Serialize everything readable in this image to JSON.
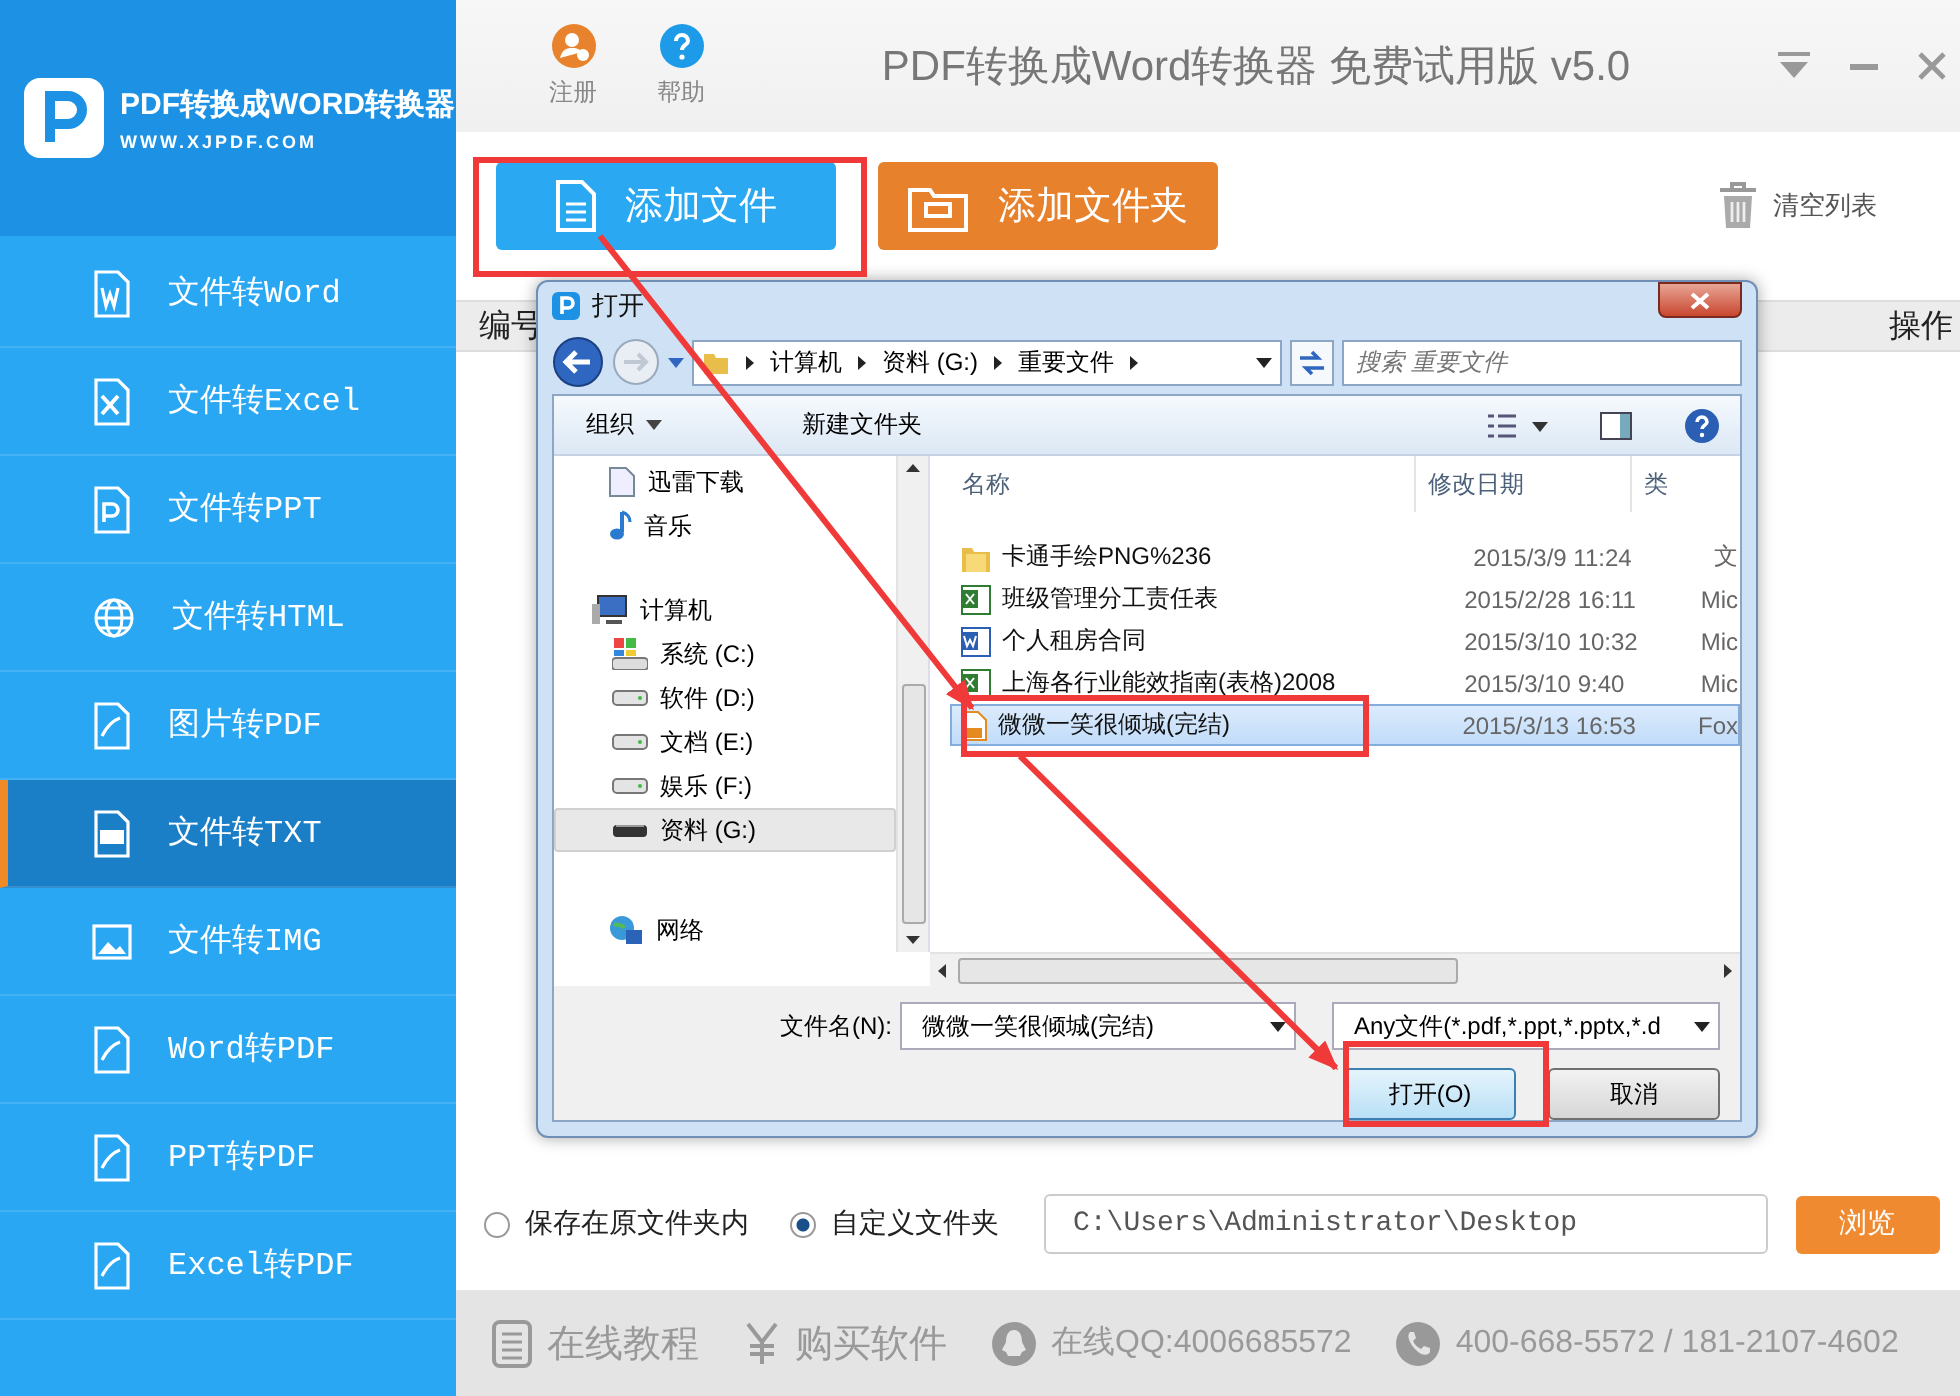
{
  "app": {
    "logo_title": "PDF转换成WORD转换器",
    "logo_url": "WWW.XJPDF.COM",
    "title": "PDF转换成Word转换器 免费试用版 v5.0"
  },
  "top_actions": [
    {
      "kind": "register",
      "label": "注册"
    },
    {
      "kind": "help",
      "label": "帮助"
    }
  ],
  "sidebar": [
    {
      "label": "文件转Word",
      "selected": false
    },
    {
      "label": "文件转Excel",
      "selected": false
    },
    {
      "label": "文件转PPT",
      "selected": false
    },
    {
      "label": "文件转HTML",
      "selected": false
    },
    {
      "label": "图片转PDF",
      "selected": false
    },
    {
      "label": "文件转TXT",
      "selected": true
    },
    {
      "label": "文件转IMG",
      "selected": false
    },
    {
      "label": "Word转PDF",
      "selected": false
    },
    {
      "label": "PPT转PDF",
      "selected": false
    },
    {
      "label": "Excel转PDF",
      "selected": false
    }
  ],
  "toolbar": {
    "add_file": "添加文件",
    "add_folder": "添加文件夹",
    "clear": "清空列表"
  },
  "table": {
    "columns": [
      "编号",
      "操作"
    ]
  },
  "dialog": {
    "title": "打开",
    "breadcrumb": [
      "计算机",
      "资料 (G:)",
      "重要文件"
    ],
    "search_placeholder": "搜索 重要文件",
    "organize": "组织",
    "new_folder": "新建文件夹",
    "nav": [
      {
        "label": "迅雷下载",
        "kind": "download",
        "selected": false
      },
      {
        "label": "音乐",
        "kind": "music",
        "selected": false
      },
      {
        "label": "计算机",
        "kind": "computer",
        "selected": false,
        "children": [
          {
            "label": "系统 (C:)",
            "kind": "system",
            "selected": false
          },
          {
            "label": "软件 (D:)",
            "kind": "drive",
            "selected": false
          },
          {
            "label": "文档 (E:)",
            "kind": "drive",
            "selected": false
          },
          {
            "label": "娱乐 (F:)",
            "kind": "drive",
            "selected": false
          },
          {
            "label": "资料 (G:)",
            "kind": "removable",
            "selected": true
          }
        ]
      },
      {
        "label": "网络",
        "kind": "network",
        "selected": false
      }
    ],
    "columns": [
      "名称",
      "修改日期",
      "类"
    ],
    "files": [
      {
        "kind": "folder",
        "name": "卡通手绘PNG%236",
        "date": "2015/3/9 11:24",
        "type": "文",
        "selected": false
      },
      {
        "kind": "excel",
        "name": "班级管理分工责任表",
        "date": "2015/2/28 16:11",
        "type": "Mic",
        "selected": false
      },
      {
        "kind": "word",
        "name": "个人租房合同",
        "date": "2015/3/10 10:32",
        "type": "Mic",
        "selected": false
      },
      {
        "kind": "excel",
        "name": "上海各行业能效指南(表格)2008",
        "date": "2015/3/10 9:40",
        "type": "Mic",
        "selected": false
      },
      {
        "kind": "pdf",
        "name": "微微一笑很倾城(完结)",
        "date": "2015/3/13 16:53",
        "type": "Fox",
        "selected": true
      }
    ],
    "filename_label": "文件名(N):",
    "filename": "微微一笑很倾城(完结)",
    "filter": "Any文件(*.pdf,*.ppt,*.pptx,*.d",
    "open": "打开(O)",
    "cancel": "取消"
  },
  "output": {
    "options": [
      {
        "label": "保存在原文件夹内",
        "selected": false
      },
      {
        "label": "自定义文件夹",
        "selected": true
      }
    ],
    "path": "C:\\Users\\Administrator\\Desktop",
    "browse": "浏览"
  },
  "footer": [
    {
      "kind": "tutorial",
      "label": "在线教程"
    },
    {
      "kind": "buy",
      "label": "购买软件"
    },
    {
      "kind": "qq",
      "label": "在线QQ:4006685572"
    },
    {
      "kind": "phone",
      "label": "400-668-5572 / 181-2107-4602"
    }
  ]
}
